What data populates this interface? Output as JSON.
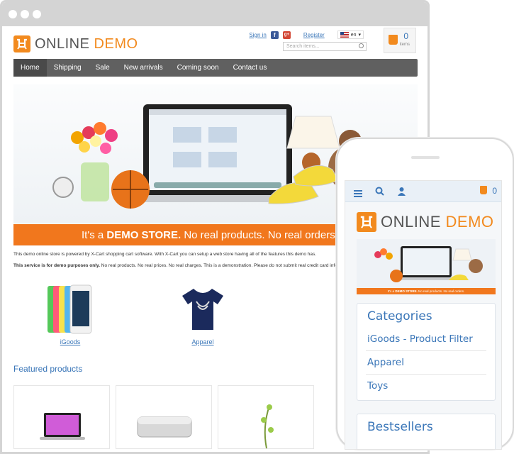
{
  "desktop": {
    "logo": {
      "online": "ONLINE",
      "demo": "DEMO"
    },
    "top_links": {
      "sign_in": "Sign in",
      "register": "Register",
      "language": "en",
      "facebook": "f",
      "google_plus": "g+"
    },
    "search": {
      "placeholder": "Search items..."
    },
    "cart": {
      "count": "0",
      "items_label": "items"
    },
    "nav": [
      {
        "label": "Home",
        "active": true
      },
      {
        "label": "Shipping"
      },
      {
        "label": "Sale"
      },
      {
        "label": "New arrivals"
      },
      {
        "label": "Coming soon"
      },
      {
        "label": "Contact us"
      }
    ],
    "banner": {
      "prefix": "It's a",
      "bold": "DEMO STORE.",
      "suffix": "No real products. No real orders."
    },
    "description": {
      "line1": "This demo online store is powered by X-Cart shopping cart software. With X-Cart you can setup a web store having all of the features this demo has.",
      "line2_bold": "This service is for demo purposes only.",
      "line2_rest": "No real products. No real prices. No real charges. This is a demonstration. Please do not submit real credit card information."
    },
    "categories": [
      {
        "label": "iGoods"
      },
      {
        "label": "Apparel"
      }
    ],
    "featured_title": "Featured products"
  },
  "mobile": {
    "logo": {
      "online": "ONLINE",
      "demo": "DEMO"
    },
    "cart_count": "0",
    "banner": {
      "prefix": "It's a",
      "bold": "DEMO STORE.",
      "suffix": "No real products. No real orders."
    },
    "categories_title": "Categories",
    "categories": [
      "iGoods - Product Filter",
      "Apparel",
      "Toys"
    ],
    "bestsellers_title": "Bestsellers"
  },
  "colors": {
    "accent": "#f28a1e",
    "link": "#3a76b8",
    "nav_bg": "#606060"
  }
}
